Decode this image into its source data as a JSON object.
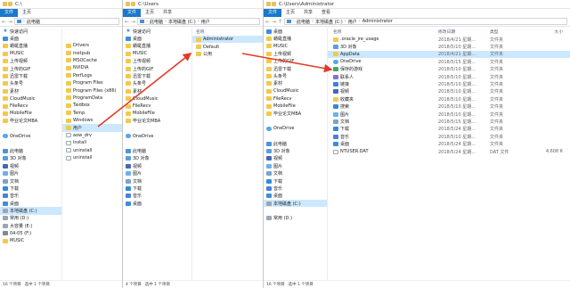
{
  "colors": {
    "accent": "#1979ca",
    "arrow": "#e23a2a",
    "folder": "#f2c94c",
    "selection": "#cce8ff"
  },
  "w1": {
    "title": "C:\\",
    "tab_file": "文件",
    "tab_home": "主页",
    "address": "此电脑",
    "nav": [
      {
        "label": "快速访问",
        "icon": "star-icon"
      },
      {
        "label": "桌面",
        "icon": "desktop-icon"
      },
      {
        "label": "蜻蜓直播",
        "icon": "folder-icon"
      },
      {
        "label": "MUSIC",
        "icon": "folder-icon"
      },
      {
        "label": "上传视频",
        "icon": "folder-icon"
      },
      {
        "label": "上传的GIF",
        "icon": "folder-icon"
      },
      {
        "label": "迅雷下载",
        "icon": "folder-icon"
      },
      {
        "label": "头条号",
        "icon": "folder-icon"
      },
      {
        "label": "素材",
        "icon": "folder-icon"
      },
      {
        "label": "CloudMusic",
        "icon": "folder-icon"
      },
      {
        "label": "FileRecv",
        "icon": "folder-icon"
      },
      {
        "label": "MobileFile",
        "icon": "folder-icon"
      },
      {
        "label": "毕业论文MBA",
        "icon": "folder-icon"
      },
      {
        "label": "",
        "icon": ""
      },
      {
        "label": "OneDrive",
        "icon": "onedrive-icon"
      },
      {
        "label": "",
        "icon": ""
      },
      {
        "label": "此电脑",
        "icon": "pc-icon"
      },
      {
        "label": "3D 对象",
        "icon": "3d-objects-icon"
      },
      {
        "label": "视频",
        "icon": "video-icon"
      },
      {
        "label": "图片",
        "icon": "pictures-icon"
      },
      {
        "label": "文档",
        "icon": "documents-icon"
      },
      {
        "label": "下载",
        "icon": "downloads-icon"
      },
      {
        "label": "音乐",
        "icon": "music-icon"
      },
      {
        "label": "桌面",
        "icon": "desktop-icon"
      },
      {
        "label": "本地磁盘 (C:)",
        "icon": "drive-icon"
      },
      {
        "label": "常用 (D:)",
        "icon": "drive-icon"
      },
      {
        "label": "大容量 (E:)",
        "icon": "drive-icon"
      },
      {
        "label": "04-05 (F:)",
        "icon": "usb-icon"
      },
      {
        "label": "MUSIC",
        "icon": "folder-icon"
      }
    ],
    "files": [
      "Drivers",
      "inetpub",
      "MSOCache",
      "NVIDIA",
      "PerfLogs",
      "Program Files",
      "Program Files (x86)",
      "ProgramData",
      "Taidbox",
      "Temp",
      "Windows",
      "用户",
      "aow_drv",
      "install",
      "uninstall",
      "uninstall"
    ],
    "status_count": "16 个项目",
    "status_selected": "选中 1 个项目"
  },
  "w2": {
    "title": "C:\\Users",
    "tab_file": "文件",
    "tab_home": "主页",
    "tab_share": "共享",
    "crumbs": [
      "此电脑",
      "本地磁盘 (C:)",
      "用户"
    ],
    "nav": [
      {
        "label": "快速访问",
        "icon": "star-icon"
      },
      {
        "label": "桌面",
        "icon": "desktop-icon"
      },
      {
        "label": "蜻蜓直播",
        "icon": "folder-icon"
      },
      {
        "label": "MUSIC",
        "icon": "folder-icon"
      },
      {
        "label": "上传视频",
        "icon": "folder-icon"
      },
      {
        "label": "上传的GIF",
        "icon": "folder-icon"
      },
      {
        "label": "迅雷下载",
        "icon": "folder-icon"
      },
      {
        "label": "头条号",
        "icon": "folder-icon"
      },
      {
        "label": "素材",
        "icon": "folder-icon"
      },
      {
        "label": "CloudMusic",
        "icon": "folder-icon"
      },
      {
        "label": "FileRecv",
        "icon": "folder-icon"
      },
      {
        "label": "MobileFile",
        "icon": "folder-icon"
      },
      {
        "label": "毕业论文MBA",
        "icon": "folder-icon"
      },
      {
        "label": "",
        "icon": ""
      },
      {
        "label": "OneDrive",
        "icon": "onedrive-icon"
      },
      {
        "label": "",
        "icon": ""
      },
      {
        "label": "此电脑",
        "icon": "pc-icon"
      },
      {
        "label": "3D 对象",
        "icon": "3d-objects-icon"
      },
      {
        "label": "视频",
        "icon": "video-icon"
      },
      {
        "label": "图片",
        "icon": "pictures-icon"
      },
      {
        "label": "文档",
        "icon": "documents-icon"
      },
      {
        "label": "下载",
        "icon": "downloads-icon"
      },
      {
        "label": "音乐",
        "icon": "music-icon"
      },
      {
        "label": "桌面",
        "icon": "desktop-icon"
      }
    ],
    "col_name": "名称",
    "files": [
      "Administrator",
      "Default",
      "公用"
    ],
    "status_count": "4 个项目",
    "status_selected": "选中 1 个项目"
  },
  "w3": {
    "title": "C:\\Users\\Administrator",
    "tab_file": "文件",
    "tab_home": "主页",
    "tab_share": "共享",
    "tab_view": "查看",
    "crumbs": [
      "此电脑",
      "本地磁盘 (C:)",
      "用户",
      "Administrator"
    ],
    "nav": [
      {
        "label": "桌面",
        "icon": "desktop-icon"
      },
      {
        "label": "蜻蜓直播",
        "icon": "folder-icon"
      },
      {
        "label": "MUSIC",
        "icon": "folder-icon"
      },
      {
        "label": "上传视频",
        "icon": "folder-icon"
      },
      {
        "label": "上传的GIF",
        "icon": "folder-icon"
      },
      {
        "label": "迅雷下载",
        "icon": "folder-icon"
      },
      {
        "label": "头条号",
        "icon": "folder-icon"
      },
      {
        "label": "素材",
        "icon": "folder-icon"
      },
      {
        "label": "CloudMusic",
        "icon": "folder-icon"
      },
      {
        "label": "FileRecv",
        "icon": "folder-icon"
      },
      {
        "label": "MobileFile",
        "icon": "folder-icon"
      },
      {
        "label": "毕业论文MBA",
        "icon": "folder-icon"
      },
      {
        "label": "",
        "icon": ""
      },
      {
        "label": "OneDrive",
        "icon": "onedrive-icon"
      },
      {
        "label": "",
        "icon": ""
      },
      {
        "label": "此电脑",
        "icon": "pc-icon"
      },
      {
        "label": "3D 对象",
        "icon": "3d-objects-icon"
      },
      {
        "label": "视频",
        "icon": "video-icon"
      },
      {
        "label": "图片",
        "icon": "pictures-icon"
      },
      {
        "label": "文档",
        "icon": "documents-icon"
      },
      {
        "label": "下载",
        "icon": "downloads-icon"
      },
      {
        "label": "音乐",
        "icon": "music-icon"
      },
      {
        "label": "桌面",
        "icon": "desktop-icon"
      },
      {
        "label": "本地磁盘 (C:)",
        "icon": "drive-icon"
      },
      {
        "label": "",
        "icon": ""
      },
      {
        "label": "常用 (D:)",
        "icon": "drive-icon"
      }
    ],
    "columns": {
      "name": "名称",
      "date": "修改日期",
      "type": "类型",
      "size": "大小"
    },
    "files": [
      {
        "name": ".oracle_jre_usage",
        "date": "2018/4/21 星期...",
        "type": "文件夹",
        "size": "",
        "icon": "folder-icon"
      },
      {
        "name": "3D 对象",
        "date": "2018/5/10 星期...",
        "type": "文件夹",
        "size": "",
        "icon": "3d-objects-icon"
      },
      {
        "name": "AppData",
        "date": "2018/4/21 星期...",
        "type": "文件夹",
        "size": "",
        "icon": "folder-icon"
      },
      {
        "name": "OneDrive",
        "date": "2018/5/15 星期...",
        "type": "文件夹",
        "size": "",
        "icon": "onedrive-icon"
      },
      {
        "name": "保存的游戏",
        "date": "2018/5/10 星期...",
        "type": "文件夹",
        "size": "",
        "icon": "saved-games-icon"
      },
      {
        "name": "联系人",
        "date": "2018/5/10 星期...",
        "type": "文件夹",
        "size": "",
        "icon": "contacts-icon"
      },
      {
        "name": "链接",
        "date": "2018/5/10 星期...",
        "type": "文件夹",
        "size": "",
        "icon": "links-icon"
      },
      {
        "name": "视频",
        "date": "2018/5/10 星期...",
        "type": "文件夹",
        "size": "",
        "icon": "video-icon"
      },
      {
        "name": "收藏夹",
        "date": "2018/5/10 星期...",
        "type": "文件夹",
        "size": "",
        "icon": "favorites-icon"
      },
      {
        "name": "搜索",
        "date": "2018/5/10 星期...",
        "type": "文件夹",
        "size": "",
        "icon": "search-icon"
      },
      {
        "name": "图片",
        "date": "2018/5/10 星期...",
        "type": "文件夹",
        "size": "",
        "icon": "pictures-icon"
      },
      {
        "name": "文档",
        "date": "2018/5/15 星期...",
        "type": "文件夹",
        "size": "",
        "icon": "documents-icon"
      },
      {
        "name": "下载",
        "date": "2018/5/24 星期...",
        "type": "文件夹",
        "size": "",
        "icon": "downloads-icon"
      },
      {
        "name": "音乐",
        "date": "2018/5/10 星期...",
        "type": "文件夹",
        "size": "",
        "icon": "music-icon"
      },
      {
        "name": "桌面",
        "date": "2018/5/24 星期...",
        "type": "文件夹",
        "size": "",
        "icon": "desktop-icon"
      },
      {
        "name": "NTUSER.DAT",
        "date": "2018/5/24 星期...",
        "type": "DAT 文件",
        "size": "4,608 K",
        "icon": "file-icon"
      }
    ],
    "status_count": "16 个项目",
    "status_selected": "选中 1 个项目"
  }
}
